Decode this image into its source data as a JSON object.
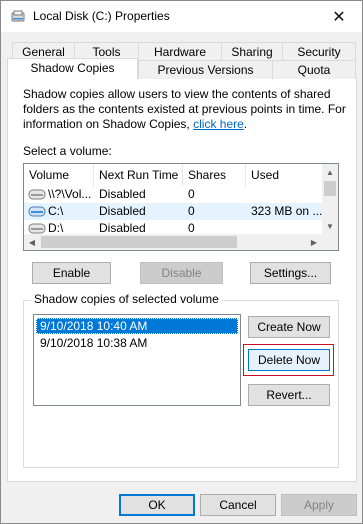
{
  "window": {
    "title": "Local Disk (C:) Properties",
    "close_glyph": "✕"
  },
  "tabs": {
    "row1": [
      "General",
      "Tools",
      "Hardware",
      "Sharing",
      "Security"
    ],
    "row2": [
      "Shadow Copies",
      "Previous Versions",
      "Quota"
    ],
    "active": "Shadow Copies"
  },
  "description": {
    "text": "Shadow copies allow users to view the contents of shared folders as the contents existed at previous points in time. For information on Shadow Copies, ",
    "link": "click here",
    "end": "."
  },
  "volumes": {
    "label": "Select a volume:",
    "columns": [
      "Volume",
      "Next Run Time",
      "Shares",
      "Used"
    ],
    "rows": [
      {
        "volume": "\\\\?\\Vol...",
        "next_run": "Disabled",
        "shares": "0",
        "used": "",
        "icon": "drive-gray-icon"
      },
      {
        "volume": "C:\\",
        "next_run": "Disabled",
        "shares": "0",
        "used": "323 MB on ...",
        "icon": "drive-system-icon",
        "selected": true
      },
      {
        "volume": "D:\\",
        "next_run": "Disabled",
        "shares": "0",
        "used": "",
        "icon": "drive-gray-icon"
      }
    ]
  },
  "volume_buttons": {
    "enable": "Enable",
    "disable": "Disable",
    "settings": "Settings..."
  },
  "shadow_copies": {
    "group_title": "Shadow copies of selected volume",
    "items": [
      "9/10/2018 10:40 AM",
      "9/10/2018 10:38 AM"
    ],
    "selected_index": 0
  },
  "shadow_buttons": {
    "create": "Create Now",
    "delete": "Delete Now",
    "revert": "Revert..."
  },
  "dialog_buttons": {
    "ok": "OK",
    "cancel": "Cancel",
    "apply": "Apply"
  },
  "colors": {
    "accent": "#0078d7",
    "highlight": "#c8102e",
    "link": "#0066cc"
  }
}
